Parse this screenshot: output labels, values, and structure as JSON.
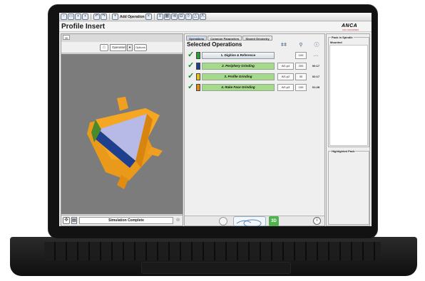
{
  "toolbar": {
    "add_operation_label": "Add Operation"
  },
  "page": {
    "title": "Profile Insert"
  },
  "logo": {
    "mark": "ANCA",
    "tagline": "CNC MACHINES"
  },
  "left_panel": {
    "tab_label": "3D",
    "operation_select": "Operation",
    "options_label": "Options",
    "status": "Simulation Complete"
  },
  "middle_panel": {
    "tabs": [
      "Operations",
      "Common Parameters",
      "Shared Geometry"
    ],
    "heading": "Selected Operations",
    "operations": [
      {
        "name": "1. Digitise & Reference",
        "wheel": "",
        "number": "100",
        "time": "- : -",
        "color": "#2e9e2e"
      },
      {
        "name": "2. Periphery Grinding",
        "wheel": "W1:p4",
        "number": "200",
        "time": "00:17",
        "color": "#1f3f8f"
      },
      {
        "name": "3. Profile Grinding",
        "wheel": "W1:p2",
        "number": "30",
        "time": "02:17",
        "color": "#e2c21a"
      },
      {
        "name": "4. Rake Face Grinding",
        "wheel": "W1:p3",
        "number": "100",
        "time": "01:28",
        "color": "#e08a18"
      }
    ],
    "bottom_3d_label": "3D"
  },
  "right_panel": {
    "pack_group_title": "Pack in Spindle",
    "mounted_label": "Mounted",
    "highlighted_title": "Highlighted Pack"
  }
}
